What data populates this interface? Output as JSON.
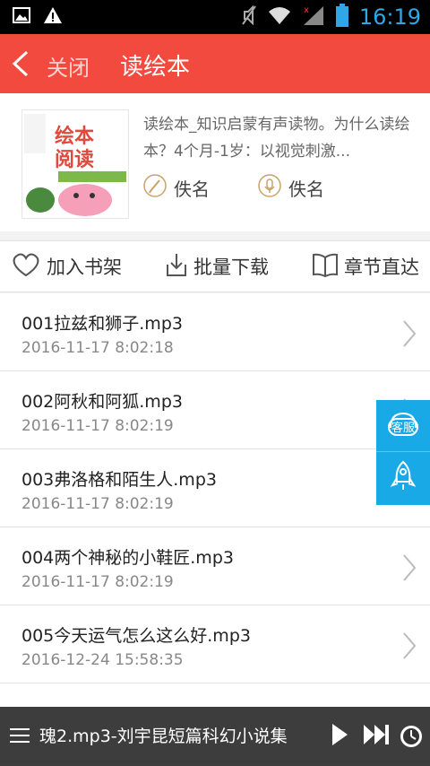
{
  "status": {
    "time": "16:19"
  },
  "header": {
    "back_icon": "chevron-left-icon",
    "close_label": "关闭",
    "title": "读绘本"
  },
  "book": {
    "cover_title": "绘本阅读",
    "description": "读绘本_知识启蒙有声读物。为什么读绘本？4个月-1岁：以视觉刺激...",
    "author": "佚名",
    "narrator": "佚名"
  },
  "actions": [
    {
      "label": "加入书架",
      "icon": "heart-icon"
    },
    {
      "label": "批量下载",
      "icon": "download-icon"
    },
    {
      "label": "章节直达",
      "icon": "book-icon"
    }
  ],
  "episodes": [
    {
      "name": "001拉兹和狮子.mp3",
      "time": "2016-11-17 8:02:18"
    },
    {
      "name": "002阿秋和阿狐.mp3",
      "time": "2016-11-17 8:02:19"
    },
    {
      "name": "003弗洛格和陌生人.mp3",
      "time": "2016-11-17 8:02:19"
    },
    {
      "name": "004两个神秘的小鞋匠.mp3",
      "time": "2016-11-17 8:02:19"
    },
    {
      "name": "005今天运气怎么这么好.mp3",
      "time": "2016-12-24 15:58:35"
    }
  ],
  "side": {
    "service_label": "客服"
  },
  "player": {
    "track": "瑰2.mp3-刘宇昆短篇科幻小说集"
  },
  "colors": {
    "accent": "#f24a3e",
    "side": "#1aa9e7"
  }
}
